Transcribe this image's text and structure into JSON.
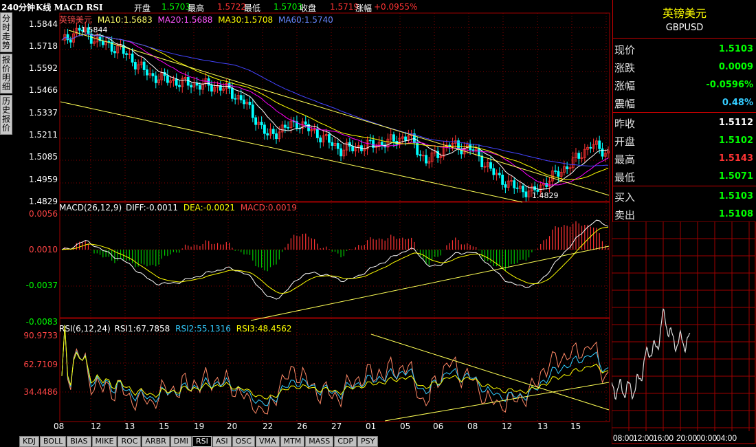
{
  "header": {
    "period": "240分钟",
    "title": "K线 MACD RSI",
    "open_label": "开盘",
    "open": "1.5703",
    "high_label": "最高",
    "high": "1.5722",
    "low_label": "最低",
    "low": "1.5703",
    "close_label": "收盘",
    "close": "1.5719",
    "change_label": "涨幅",
    "change": "+0.0955%"
  },
  "left_tabs": [
    "分时走势",
    "报价明细",
    "历史报价"
  ],
  "main_panel": {
    "symbol": "英镑美元",
    "ma10_label": "MA10:",
    "ma10": "1.5683",
    "ma20_label": "MA20:",
    "ma20": "1.5688",
    "ma30_label": "MA30:",
    "ma30": "1.5708",
    "ma60_label": "MA60:",
    "ma60": "1.5740",
    "y_ticks": [
      "1.5844",
      "1.5718",
      "1.5592",
      "1.5466",
      "1.5337",
      "1.5211",
      "1.5085",
      "1.4959",
      "1.4829"
    ],
    "high_marker": "1.5844",
    "low_marker": "1.4829"
  },
  "macd_panel": {
    "label": "MACD(26,12,9)",
    "diff_label": "DIFF:",
    "diff": "-0.0011",
    "dea_label": "DEA:",
    "dea": "-0.0021",
    "macd_label": "MACD:",
    "macd": "0.0019",
    "y_ticks": [
      "0.0056",
      "0.0010",
      "-0.0037",
      "-0.0083"
    ]
  },
  "rsi_panel": {
    "label": "RSI(6,12,24)",
    "rsi1_label": "RSI1:",
    "rsi1": "67.7858",
    "rsi2_label": "RSI2:",
    "rsi2": "55.1316",
    "rsi3_label": "RSI3:",
    "rsi3": "48.4562",
    "y_ticks": [
      "90.9733",
      "62.7109",
      "34.4486"
    ]
  },
  "x_axis": [
    "08",
    "12",
    "13",
    "15",
    "19",
    "20",
    "22",
    "26",
    "27",
    "01",
    "05",
    "06",
    "08",
    "12",
    "13",
    "15"
  ],
  "bottom_tabs": [
    "KDJ",
    "BOLL",
    "BIAS",
    "MIKE",
    "ROC",
    "ARBR",
    "DMI",
    "RSI",
    "ASI",
    "OSC",
    "VMA",
    "MTM",
    "MASS",
    "CDP",
    "PSY"
  ],
  "active_tab": "RSI",
  "quote": {
    "name": "英镑美元",
    "code": "GBPUSD",
    "rows": [
      {
        "label": "现价",
        "value": "1.5103",
        "color": "#00ff00"
      },
      {
        "label": "涨跌",
        "value": "0.0009",
        "color": "#00ff00"
      },
      {
        "label": "涨幅",
        "value": "-0.0596%",
        "color": "#00ff00"
      },
      {
        "label": "震幅",
        "value": "0.48%",
        "color": "#33ccff"
      },
      {
        "label": "昨收",
        "value": "1.5112",
        "color": "#ffffff"
      },
      {
        "label": "开盘",
        "value": "1.5102",
        "color": "#00ff00"
      },
      {
        "label": "最高",
        "value": "1.5143",
        "color": "#ff3333"
      },
      {
        "label": "最低",
        "value": "1.5071",
        "color": "#00ff00"
      },
      {
        "label": "买入",
        "value": "1.5103",
        "color": "#00ff00"
      },
      {
        "label": "卖出",
        "value": "1.5108",
        "color": "#00ff00"
      }
    ]
  },
  "mini_chart": {
    "x_labels": [
      "08:00",
      "12:00",
      "16:00",
      "20:00",
      "00:00",
      "04:00"
    ]
  },
  "colors": {
    "up": "#ff3333",
    "down": "#00ffff",
    "ma10": "#ffffff",
    "ma20": "#ff00ff",
    "ma30": "#ffff00",
    "ma60": "#4444ff",
    "grid": "#a00000",
    "axis_text": "#ff4444",
    "macd_up": "#ff3333",
    "macd_down": "#00cc00"
  }
}
